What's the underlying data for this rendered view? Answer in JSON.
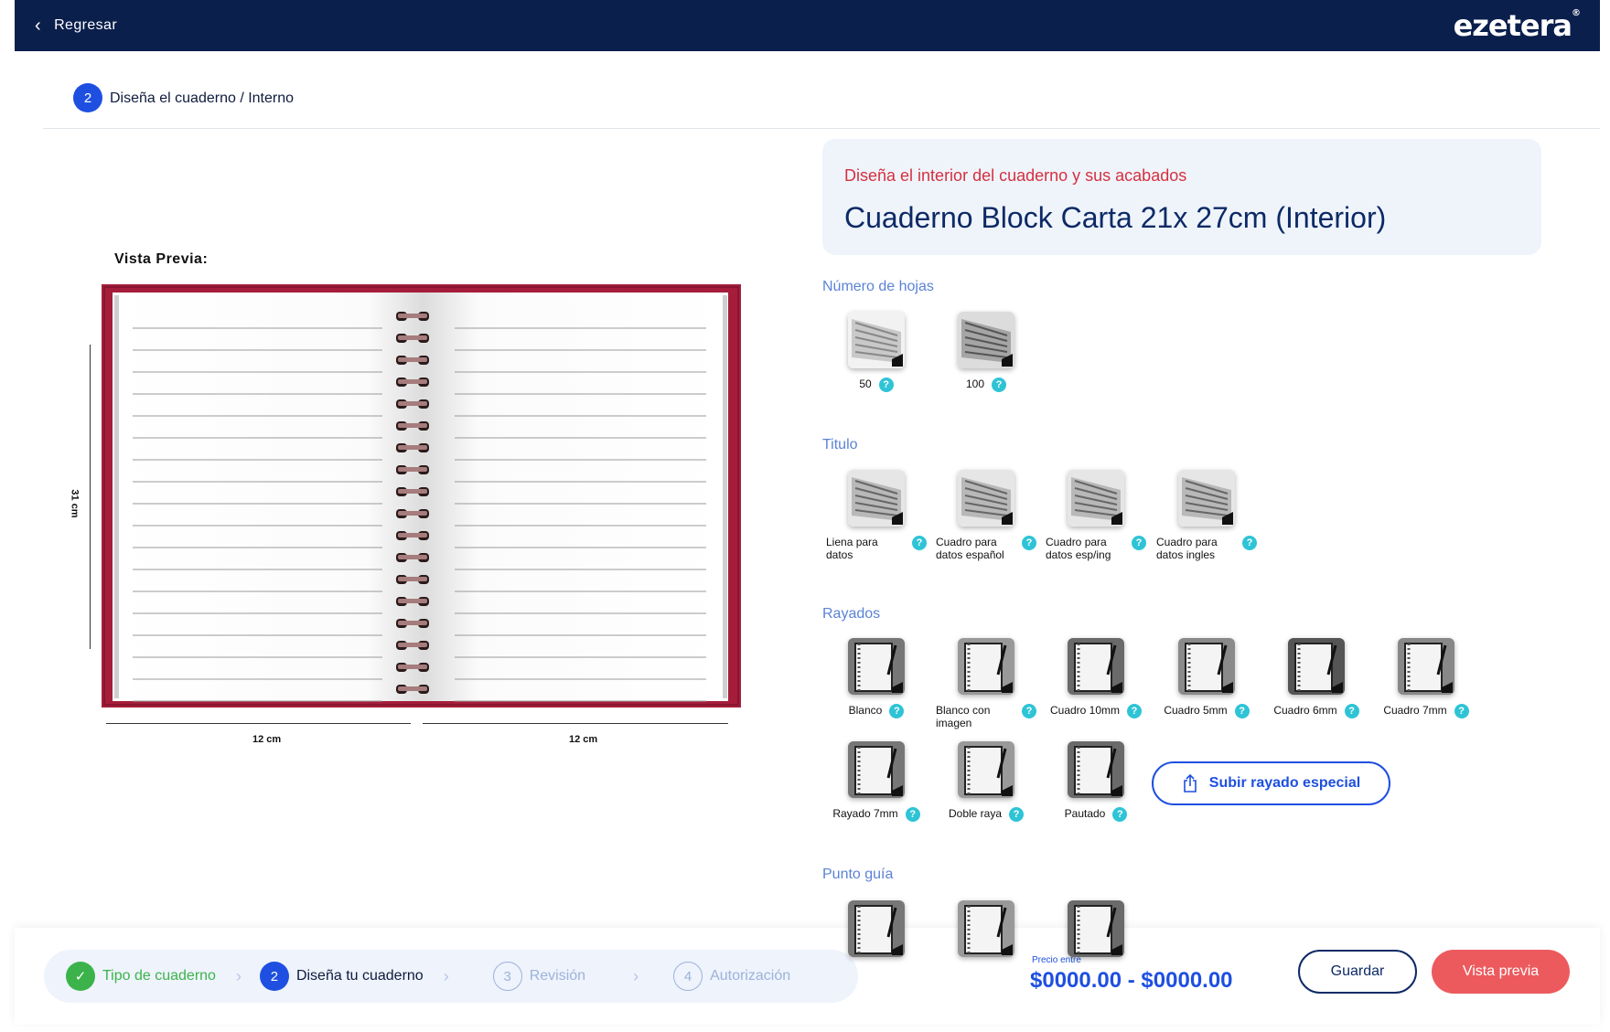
{
  "header": {
    "back_label": "Regresar",
    "logo": "ezetera",
    "logo_mark": "®"
  },
  "step": {
    "number": "2",
    "label": "Diseña el cuaderno / Interno"
  },
  "preview": {
    "label": "Vista Previa:",
    "height_label": "31 cm",
    "width_left_label": "12 cm",
    "width_right_label": "12 cm"
  },
  "info": {
    "subtitle": "Diseña el interior  del cuaderno y sus acabados",
    "title": "Cuaderno Block Carta 21x 27cm (Interior)"
  },
  "sections": {
    "hojas": {
      "title": "Número de hojas",
      "options": [
        "50",
        "100"
      ]
    },
    "titulo": {
      "title": "Titulo",
      "options": [
        "Liena para datos",
        "Cuadro para datos español",
        "Cuadro para datos esp/ing",
        "Cuadro para datos ingles"
      ]
    },
    "rayados": {
      "title": "Rayados",
      "options": [
        "Blanco",
        "Blanco con imagen",
        "Cuadro 10mm",
        "Cuadro 5mm",
        "Cuadro 6mm",
        "Cuadro 7mm",
        "Rayado 7mm",
        "Doble raya",
        "Pautado"
      ],
      "upload_label": "Subir rayado especial"
    },
    "punto": {
      "title": "Punto guía"
    }
  },
  "help_glyph": "?",
  "footer": {
    "steps": [
      {
        "num": "✓",
        "label": "Tipo de cuaderno"
      },
      {
        "num": "2",
        "label": "Diseña tu cuaderno"
      },
      {
        "num": "3",
        "label": "Revisión"
      },
      {
        "num": "4",
        "label": "Autorización"
      }
    ],
    "price_label": "Precio entre",
    "price": "$0000.00 - $0000.00",
    "save_label": "Guardar",
    "preview_label": "Vista previa"
  },
  "colors": {
    "navy": "#0b1f4d",
    "blue": "#1e4fe0",
    "red_accent": "#d6303f",
    "cover": "#a51d3a",
    "help": "#2ec4d6",
    "green": "#3cb34a",
    "preview_button": "#ec5a5e"
  }
}
